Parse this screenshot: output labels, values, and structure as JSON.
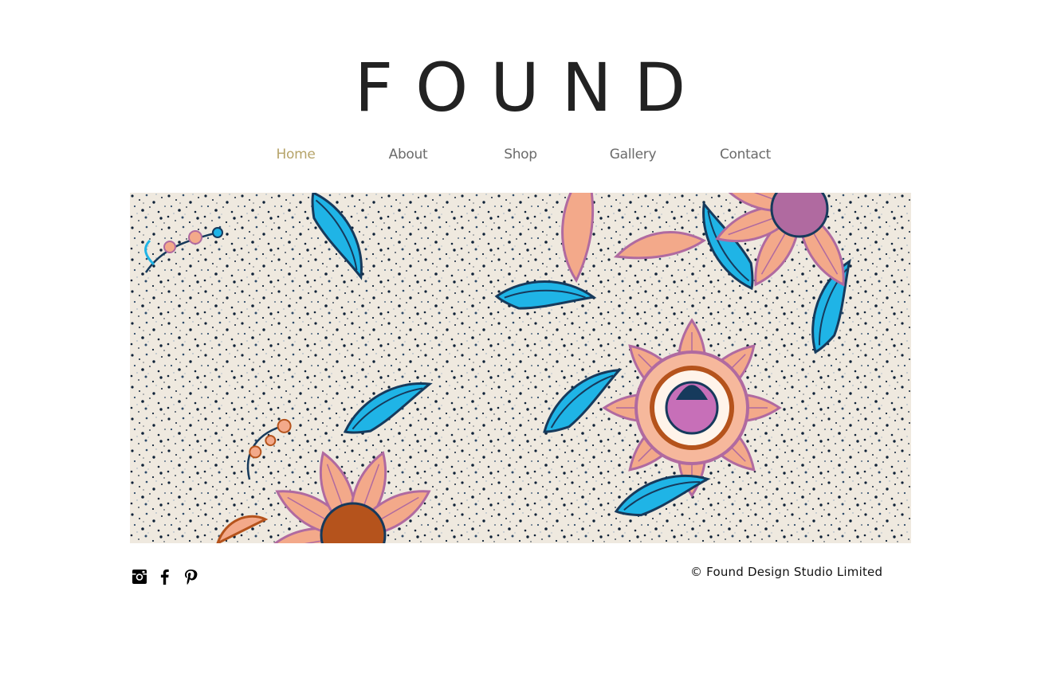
{
  "site": {
    "logo": "FOUND"
  },
  "nav": {
    "items": [
      {
        "label": "Home",
        "active": true
      },
      {
        "label": "About",
        "active": false
      },
      {
        "label": "Shop",
        "active": false
      },
      {
        "label": "Gallery",
        "active": false
      },
      {
        "label": "Contact",
        "active": false
      }
    ],
    "active_color": "#b6a46a",
    "color": "#6b6b6b"
  },
  "hero": {
    "image": "floral-batik-pattern",
    "colors": {
      "background": "#efe9df",
      "navy": "#163a5c",
      "cyan": "#1fb4e6",
      "peach": "#f3a98a",
      "mauve": "#b06aa0",
      "rust": "#b5531c"
    }
  },
  "footer": {
    "social": [
      {
        "icon": "instagram-icon"
      },
      {
        "icon": "facebook-icon"
      },
      {
        "icon": "pinterest-icon"
      }
    ],
    "copyright": "© Found Design Studio Limited"
  }
}
